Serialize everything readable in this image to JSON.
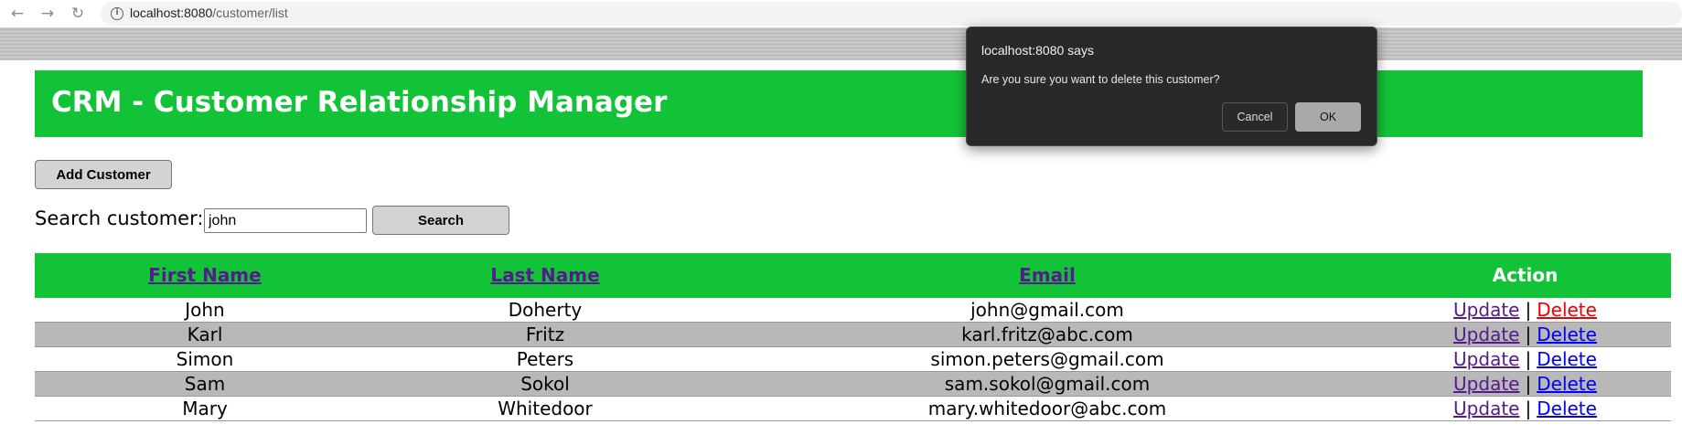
{
  "browser": {
    "url_host": "localhost:8080",
    "url_path": "/customer/list",
    "back_icon": "arrow-left-icon",
    "forward_icon": "arrow-right-icon",
    "reload_icon": "reload-icon",
    "info_icon": "info-icon"
  },
  "header": {
    "title": "CRM - Customer Relationship Manager",
    "bg_color": "#13c337"
  },
  "toolbar": {
    "add_customer_label": "Add Customer",
    "search_label": "Search customer:",
    "search_value": "john",
    "search_button_label": "Search"
  },
  "table": {
    "columns": [
      "First Name",
      "Last Name",
      "Email",
      "Action"
    ],
    "rows": [
      {
        "first": "John",
        "last": "Doherty",
        "email": "john@gmail.com",
        "update": "Update",
        "delete": "Delete"
      },
      {
        "first": "Karl",
        "last": "Fritz",
        "email": "karl.fritz@abc.com",
        "update": "Update",
        "delete": "Delete"
      },
      {
        "first": "Simon",
        "last": "Peters",
        "email": "simon.peters@gmail.com",
        "update": "Update",
        "delete": "Delete"
      },
      {
        "first": "Sam",
        "last": "Sokol",
        "email": "sam.sokol@gmail.com",
        "update": "Update",
        "delete": "Delete"
      },
      {
        "first": "Mary",
        "last": "Whitedoor",
        "email": "mary.whitedoor@abc.com",
        "update": "Update",
        "delete": "Delete"
      }
    ],
    "separator": "|"
  },
  "dialog": {
    "title": "localhost:8080 says",
    "message": "Are you sure you want to delete this customer?",
    "cancel_label": "Cancel",
    "ok_label": "OK"
  },
  "colors": {
    "accent_green": "#13c337",
    "visited_link": "#551a8b",
    "link": "#0000ee",
    "active_link": "#ee0000"
  }
}
